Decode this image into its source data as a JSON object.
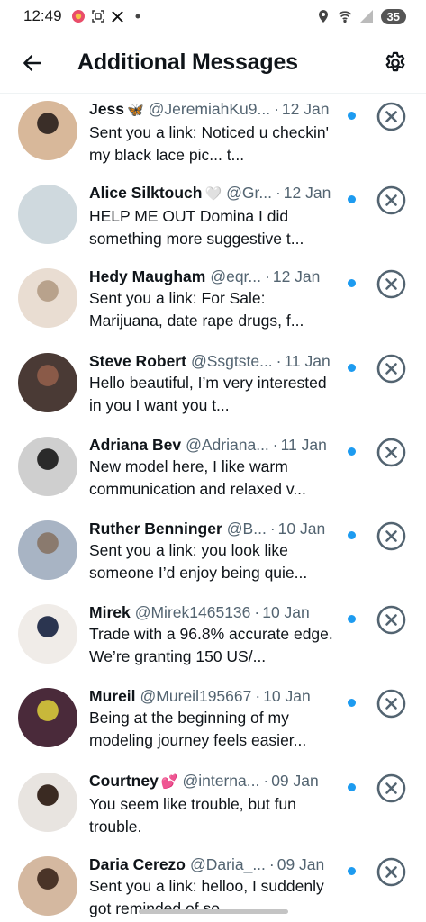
{
  "status_bar": {
    "time": "12:49",
    "battery": "35",
    "icons": [
      "app-notification-icon",
      "screenshot-icon",
      "x-logo-icon",
      "more-dot-icon",
      "location-icon",
      "wifi-icon",
      "signal-icon",
      "battery-icon"
    ]
  },
  "header": {
    "title": "Additional Messages",
    "back_icon": "back-arrow-icon",
    "settings_icon": "gear-icon"
  },
  "colors": {
    "accent": "#1d9bf0",
    "secondary_text": "#536471",
    "divider": "#eff3f4"
  },
  "messages": [
    {
      "name": "Jess",
      "emoji": "🦋",
      "handle": "@JeremiahKu9...",
      "date": "12 Jan",
      "preview": "Sent you a link: Noticed u checkin' my black lace pic... t...",
      "unread": true,
      "avatar_colors": [
        "#d8b89a",
        "#3a2e28"
      ]
    },
    {
      "name": "Alice Silktouch",
      "emoji": "🤍",
      "handle": "@Gr...",
      "date": "12 Jan",
      "preview": "HELP ME OUT Domina I did something more suggestive t...",
      "unread": true,
      "avatar_colors": [
        "#cfd9de",
        "#cfd9de"
      ]
    },
    {
      "name": "Hedy Maugham",
      "emoji": "",
      "handle": "@eqr...",
      "date": "12 Jan",
      "preview": "Sent you a link: For Sale: Marijuana, date rape drugs, f...",
      "unread": true,
      "avatar_colors": [
        "#e9ddd2",
        "#b8a28c"
      ]
    },
    {
      "name": "Steve Robert",
      "emoji": "",
      "handle": "@Ssgtste...",
      "date": "11 Jan",
      "preview": "Hello beautiful, I’m very interested in you I want you t...",
      "unread": true,
      "avatar_colors": [
        "#4a3a35",
        "#8a5a48"
      ]
    },
    {
      "name": "Adriana Bev",
      "emoji": "",
      "handle": "@Adriana...",
      "date": "11 Jan",
      "preview": "New model here, I like warm communication and relaxed v...",
      "unread": true,
      "avatar_colors": [
        "#cfcfcf",
        "#2a2a2a"
      ]
    },
    {
      "name": "Ruther Benninger",
      "emoji": "",
      "handle": "@B...",
      "date": "10 Jan",
      "preview": "Sent you a link: you look like someone I’d enjoy being quie...",
      "unread": true,
      "avatar_colors": [
        "#a8b4c4",
        "#8a7a6e"
      ]
    },
    {
      "name": "Mirek",
      "emoji": "",
      "handle": "@Mirek1465136",
      "date": "10 Jan",
      "preview": "Trade with a 96.8% accurate edge. We’re granting 150 US/...",
      "unread": true,
      "avatar_colors": [
        "#f0ece8",
        "#2b3550"
      ]
    },
    {
      "name": "Mureil",
      "emoji": "",
      "handle": "@Mureil195667",
      "date": "10 Jan",
      "preview": "Being at the beginning of my modeling journey feels easier...",
      "unread": true,
      "avatar_colors": [
        "#4a2a3a",
        "#c8b83a"
      ]
    },
    {
      "name": "Courtney",
      "emoji": "💕",
      "handle": "@interna...",
      "date": "09 Jan",
      "preview": "You seem like trouble, but fun trouble.",
      "unread": true,
      "avatar_colors": [
        "#e8e4e0",
        "#3a2a22"
      ]
    },
    {
      "name": "Daria Cerezo",
      "emoji": "",
      "handle": "@Daria_...",
      "date": "09 Jan",
      "preview": "Sent you a link: helloo, I suddenly got reminded of so...",
      "unread": true,
      "avatar_colors": [
        "#d4b8a0",
        "#4a3428"
      ]
    }
  ]
}
